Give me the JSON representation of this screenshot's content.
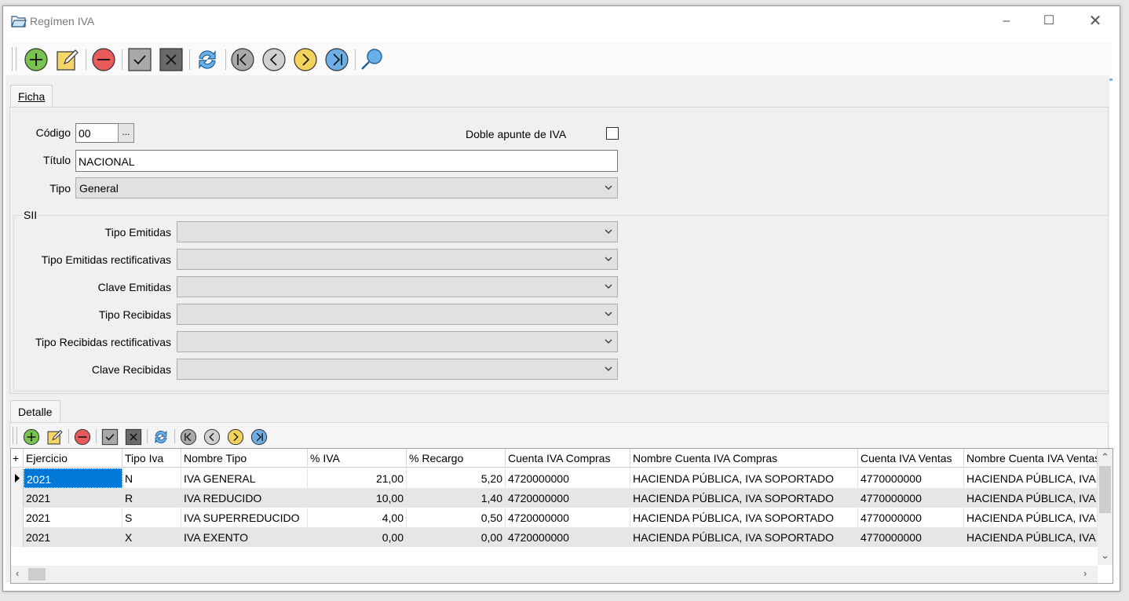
{
  "window": {
    "title": "Regímen IVA"
  },
  "tabs": {
    "ficha": "Ficha",
    "detalle": "Detalle"
  },
  "form": {
    "codigo_label": "Código",
    "codigo_value": "00",
    "codigo_button": "...",
    "doble_label": "Doble apunte de IVA",
    "titulo_label": "Título",
    "titulo_value": "NACIONAL",
    "tipo_label": "Tipo",
    "tipo_value": "General"
  },
  "sii": {
    "group_label": "SII",
    "fields": [
      {
        "label": "Tipo Emitidas",
        "value": ""
      },
      {
        "label": "Tipo Emitidas rectificativas",
        "value": ""
      },
      {
        "label": "Clave Emitidas",
        "value": ""
      },
      {
        "label": "Tipo Recibidas",
        "value": ""
      },
      {
        "label": "Tipo Recibidas rectificativas",
        "value": ""
      },
      {
        "label": "Clave Recibidas",
        "value": ""
      }
    ]
  },
  "toolbar_icons": [
    "add-icon",
    "edit-icon",
    "delete-icon",
    "confirm-icon",
    "cancel-icon",
    "refresh-icon",
    "first-record-icon",
    "previous-record-icon",
    "next-record-icon",
    "last-record-icon",
    "search-icon"
  ],
  "grid": {
    "corner": "+",
    "columns": [
      "Ejercicio",
      "Tipo Iva",
      "Nombre Tipo",
      "% IVA",
      "% Recargo",
      "Cuenta IVA Compras",
      "Nombre Cuenta IVA Compras",
      "Cuenta IVA Ventas",
      "Nombre Cuenta IVA Ventas"
    ],
    "rows": [
      [
        "2021",
        "N",
        "IVA GENERAL",
        "21,00",
        "5,20",
        "4720000000",
        "HACIENDA PÚBLICA, IVA SOPORTADO",
        "4770000000",
        "HACIENDA PÚBLICA, IVA REPERCUTIDO"
      ],
      [
        "2021",
        "R",
        "IVA REDUCIDO",
        "10,00",
        "1,40",
        "4720000000",
        "HACIENDA PÚBLICA, IVA SOPORTADO",
        "4770000000",
        "HACIENDA PÚBLICA, IVA REPERCUTIDO"
      ],
      [
        "2021",
        "S",
        "IVA SUPERREDUCIDO",
        "4,00",
        "0,50",
        "4720000000",
        "HACIENDA PÚBLICA, IVA SOPORTADO",
        "4770000000",
        "HACIENDA PÚBLICA, IVA REPERCUTIDO"
      ],
      [
        "2021",
        "X",
        "IVA EXENTO",
        "0,00",
        "0,00",
        "4720000000",
        "HACIENDA PÚBLICA, IVA SOPORTADO",
        "4770000000",
        "HACIENDA PÚBLICA, IVA REPERCUTIDO"
      ]
    ]
  },
  "colors": {
    "accent": "#7fb1df",
    "selected_cell": "#0078d7",
    "alt_row": "#e6e6e6"
  }
}
